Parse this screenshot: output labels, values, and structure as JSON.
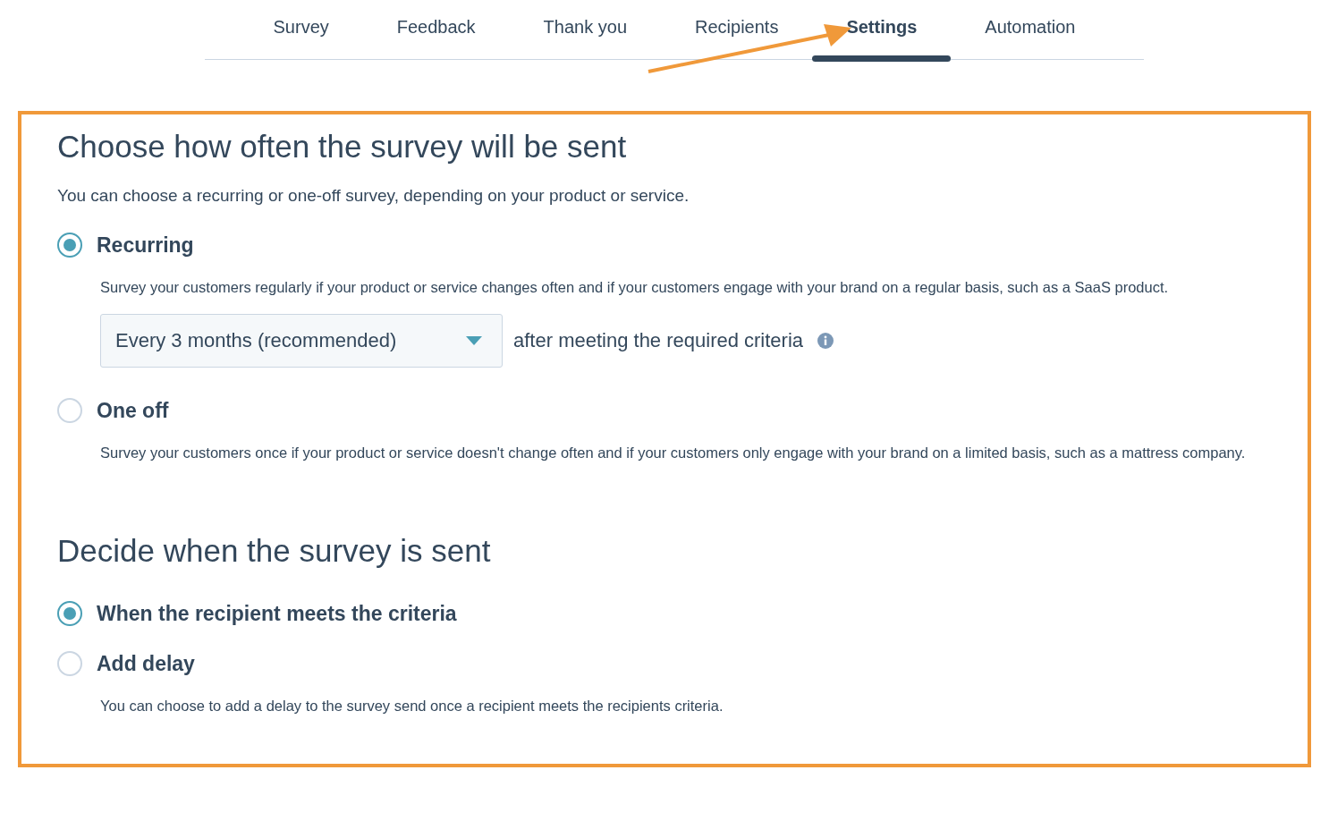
{
  "tabs": [
    {
      "label": "Survey",
      "selected": false
    },
    {
      "label": "Feedback",
      "selected": false
    },
    {
      "label": "Thank you",
      "selected": false
    },
    {
      "label": "Recipients",
      "selected": false
    },
    {
      "label": "Settings",
      "selected": true
    },
    {
      "label": "Automation",
      "selected": false
    }
  ],
  "sections": [
    {
      "heading": "Choose how often the survey will be sent",
      "intro": "You can choose a recurring or one-off survey, depending on your product or service.",
      "options": [
        {
          "label": "Recurring",
          "selected": true,
          "description": "Survey your customers regularly if your product or service changes often and if your customers engage with your brand on a regular basis, such as a SaaS product.",
          "frequency": {
            "value": "Every 3 months (recommended)",
            "suffix": "after meeting the required criteria"
          }
        },
        {
          "label": "One off",
          "selected": false,
          "description": "Survey your customers once if your product or service doesn't change often and if your customers only engage with your brand on a limited basis, such as a mattress company."
        }
      ]
    },
    {
      "heading": "Decide when the survey is sent",
      "options": [
        {
          "label": "When the recipient meets the criteria",
          "selected": true
        },
        {
          "label": "Add delay",
          "selected": false,
          "description": "You can choose to add a delay to the survey send once a recipient meets the recipients criteria."
        }
      ]
    }
  ]
}
